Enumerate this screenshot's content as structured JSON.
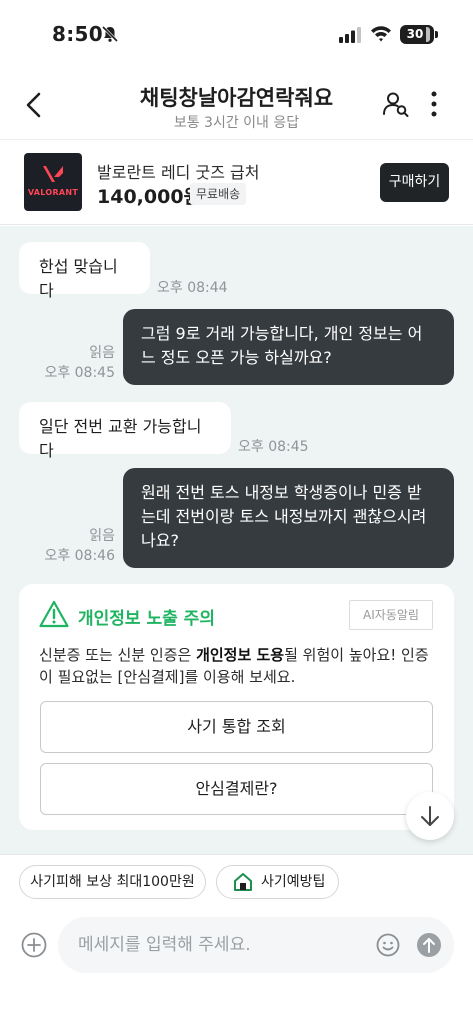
{
  "status_bar": {
    "time": "8:50",
    "battery": "30"
  },
  "header": {
    "title": "채팅창날아감연락줘요",
    "subtitle": "보통 3시간 이내 응답"
  },
  "product": {
    "name": "발로란트 레디 굿즈 급처",
    "price": "140,000원",
    "shipping_badge": "무료배송",
    "buy_label": "구매하기",
    "thumb_brand": "VALORANT"
  },
  "messages": [
    {
      "dir": "in",
      "text": "한섭 맞습니다",
      "time": "오후 08:44"
    },
    {
      "dir": "out",
      "text": "그럼 9로 거래 가능합니다, 개인 정보는 어느 정도 오픈 가능 하실까요?",
      "read": "읽음",
      "time": "오후 08:45"
    },
    {
      "dir": "in",
      "text": "일단 전번 교환 가능합니다",
      "time": "오후 08:45"
    },
    {
      "dir": "out",
      "text": "원래 전번 토스 내정보 학생증이나 민증 받는데 전번이랑 토스 내정보까지 괜찮으시려나요?",
      "read": "읽음",
      "time": "오후 08:46"
    }
  ],
  "warning": {
    "title": "개인정보 노출 주의",
    "tag": "AI자동알림",
    "text_1": "신분증 또는 신분 인증은 ",
    "text_bold": "개인정보 도용",
    "text_2": "될 위험이 높아요! 인증이 필요없는 [안심결제]를 이용해 보세요.",
    "button_1": "사기 통합 조회",
    "button_2": "안심결제란?"
  },
  "chips": {
    "compensation": "사기피해 보상 최대100만원",
    "tips": "사기예방팁"
  },
  "input": {
    "placeholder": "메세지를 입력해 주세요."
  },
  "colors": {
    "accent_green": "#20b461",
    "outgoing_bubble": "#363b3f",
    "chat_bg": "#eef3f3"
  }
}
